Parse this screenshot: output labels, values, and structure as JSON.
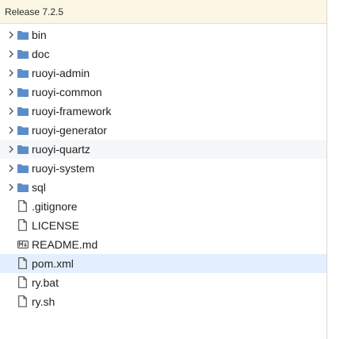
{
  "header": {
    "title": "Release 7.2.5"
  },
  "colors": {
    "header_bg": "#fbf7e4",
    "folder": "#5b8dc9",
    "selected_row": "#e3efff",
    "hover_row": "#f6f7f9"
  },
  "tree": {
    "items": [
      {
        "type": "folder",
        "label": "bin",
        "icon": "folder-icon"
      },
      {
        "type": "folder",
        "label": "doc",
        "icon": "folder-icon"
      },
      {
        "type": "folder",
        "label": "ruoyi-admin",
        "icon": "folder-icon"
      },
      {
        "type": "folder",
        "label": "ruoyi-common",
        "icon": "folder-icon"
      },
      {
        "type": "folder",
        "label": "ruoyi-framework",
        "icon": "folder-icon"
      },
      {
        "type": "folder",
        "label": "ruoyi-generator",
        "icon": "folder-icon"
      },
      {
        "type": "folder",
        "label": "ruoyi-quartz",
        "icon": "folder-icon",
        "state": "hover"
      },
      {
        "type": "folder",
        "label": "ruoyi-system",
        "icon": "folder-icon"
      },
      {
        "type": "folder",
        "label": "sql",
        "icon": "folder-icon"
      },
      {
        "type": "file",
        "label": ".gitignore",
        "icon": "file-icon"
      },
      {
        "type": "file",
        "label": "LICENSE",
        "icon": "file-icon"
      },
      {
        "type": "file",
        "label": "README.md",
        "icon": "markdown-icon"
      },
      {
        "type": "file",
        "label": "pom.xml",
        "icon": "file-icon",
        "state": "selected"
      },
      {
        "type": "file",
        "label": "ry.bat",
        "icon": "file-icon"
      },
      {
        "type": "file",
        "label": "ry.sh",
        "icon": "file-icon"
      }
    ]
  }
}
